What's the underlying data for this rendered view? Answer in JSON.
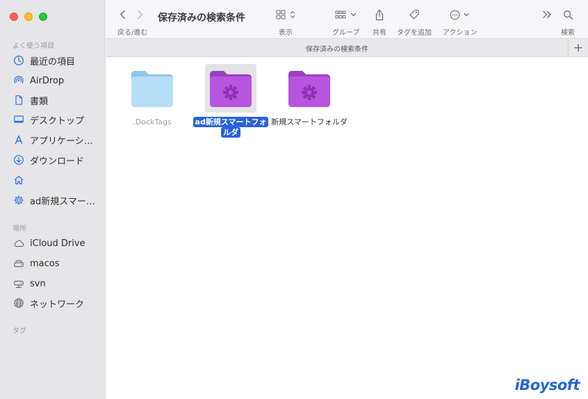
{
  "sidebar": {
    "favorites_title": "よく使う項目",
    "favorites": [
      {
        "label": "最近の項目",
        "icon": "clock-icon"
      },
      {
        "label": "AirDrop",
        "icon": "airdrop-icon"
      },
      {
        "label": "書類",
        "icon": "document-icon"
      },
      {
        "label": "デスクトップ",
        "icon": "desktop-icon"
      },
      {
        "label": "アプリケーシ…",
        "icon": "applications-icon"
      },
      {
        "label": "ダウンロード",
        "icon": "download-icon"
      },
      {
        "label": "",
        "icon": "home-icon"
      },
      {
        "label": "ad新規スマー…",
        "icon": "gear-folder-icon"
      }
    ],
    "locations_title": "場所",
    "locations": [
      {
        "label": "iCloud Drive",
        "icon": "cloud-icon"
      },
      {
        "label": "macos",
        "icon": "disk-icon"
      },
      {
        "label": "svn",
        "icon": "network-disk-icon"
      },
      {
        "label": "ネットワーク",
        "icon": "globe-icon"
      }
    ],
    "tags_title": "タグ"
  },
  "toolbar": {
    "window_title": "保存済みの検索条件",
    "back_forward_label": "戻る/進む",
    "view_label": "表示",
    "group_label": "グループ",
    "share_label": "共有",
    "tag_label": "タグを追加",
    "action_label": "アクション",
    "search_label": "検索"
  },
  "tabbar": {
    "title": "保存済みの検索条件",
    "add_label": "+"
  },
  "files": [
    {
      "name": ".DockTags",
      "type": "folder",
      "color": "#a3d3f2"
    },
    {
      "name": "ad新規スマートフォルダ",
      "type": "smart-folder",
      "color": "#b14fd7",
      "selected": true
    },
    {
      "name": "新規スマートフォルダ",
      "type": "smart-folder",
      "color": "#b14fd7"
    }
  ],
  "watermark": "iBoysoft",
  "colors": {
    "selection": "#2b63d9",
    "smart_folder": "#b14fd7",
    "plain_folder": "#a3d3f2",
    "sidebar_icon": "#2a72e2"
  }
}
